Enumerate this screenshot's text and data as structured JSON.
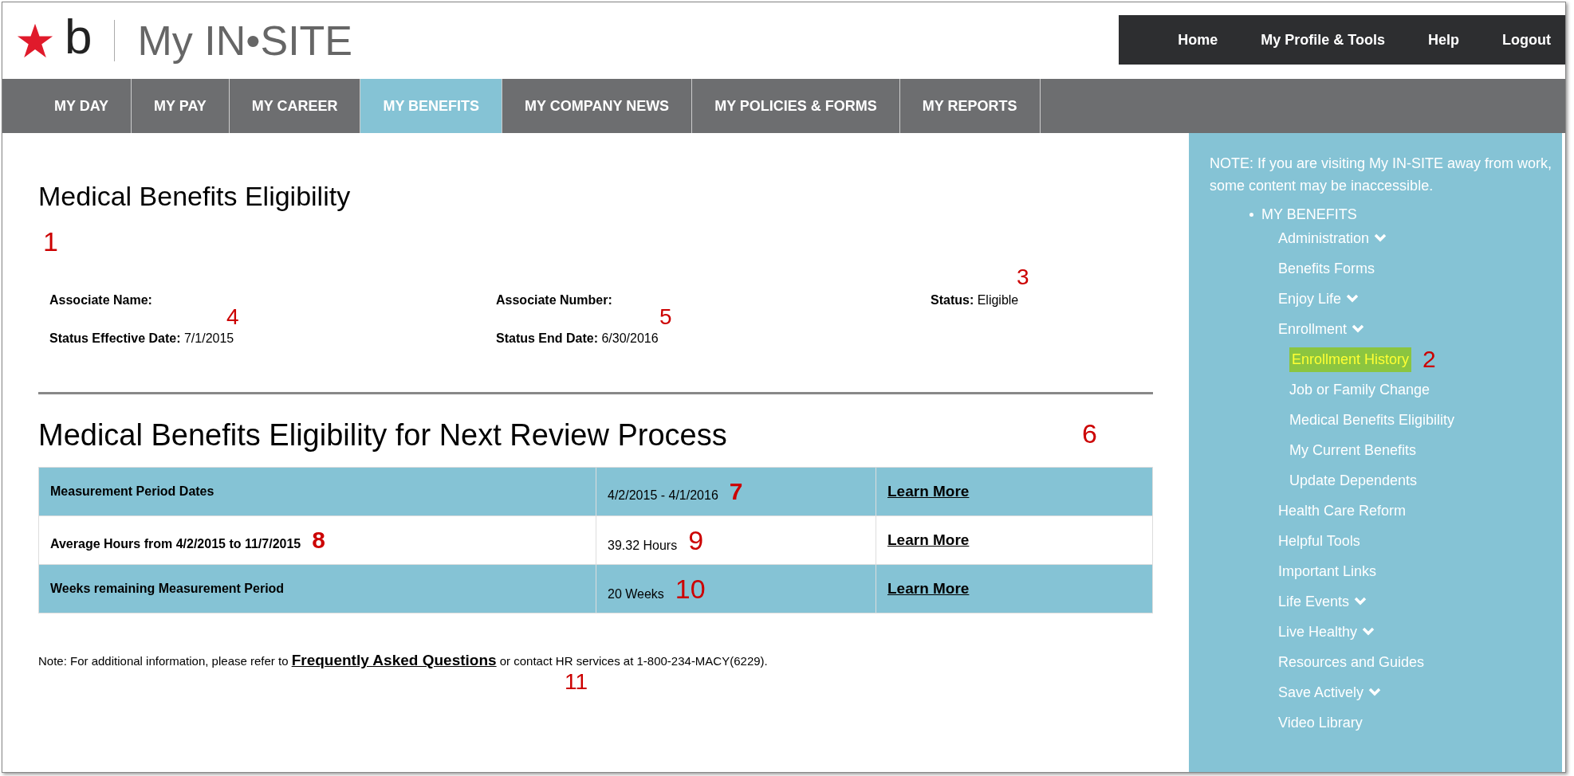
{
  "logo": {
    "letter": "b",
    "site_name": "My IN•SITE"
  },
  "top_links": [
    "Home",
    "My Profile & Tools",
    "Help",
    "Logout"
  ],
  "tabs": [
    {
      "label": "MY DAY",
      "selected": false
    },
    {
      "label": "MY PAY",
      "selected": false
    },
    {
      "label": "MY CAREER",
      "selected": false
    },
    {
      "label": "MY BENEFITS",
      "selected": true
    },
    {
      "label": "MY COMPANY NEWS",
      "selected": false
    },
    {
      "label": "MY POLICIES & FORMS",
      "selected": false
    },
    {
      "label": "MY REPORTS",
      "selected": false
    }
  ],
  "main": {
    "title": "Medical Benefits Eligibility",
    "title_marker": "1",
    "fields": [
      {
        "label": "Associate Name:",
        "marker": "4"
      },
      {
        "label": "Associate Number:",
        "marker": "5"
      },
      {
        "label": "Status:",
        "value": "Eligible",
        "marker": "3"
      },
      {
        "label": "Status Effective Date:",
        "value": "7/1/2015"
      },
      {
        "label": "Status End Date:",
        "value": "6/30/2016"
      }
    ],
    "section_title": "Medical Benefits Eligibility for Next Review Process",
    "section_marker": "6",
    "table": {
      "rows": [
        {
          "label": "Measurement Period Dates",
          "value": "4/2/2015 - 4/1/2016",
          "value_marker": "7",
          "link": "Learn More",
          "shaded": true
        },
        {
          "label": "Average Hours from 4/2/2015 to 11/7/2015",
          "label_marker": "8",
          "value": "39.32 Hours",
          "value_marker": "9",
          "link": "Learn More",
          "shaded": false
        },
        {
          "label": "Weeks remaining Measurement Period",
          "value": "20 Weeks",
          "value_marker": "10",
          "link": "Learn More",
          "shaded": true
        }
      ]
    },
    "note": {
      "before": "Note: For additional information, please refer to",
      "link": "Frequently Asked Questions",
      "after": "or contact HR services at 1-800-234-MACY(6229).",
      "marker": "11"
    }
  },
  "sidebar": {
    "note": "NOTE: If you are visiting My IN-SITE away from work, some content may be inaccessible.",
    "section": "MY BENEFITS",
    "items": [
      {
        "label": "Administration",
        "expandable": true
      },
      {
        "label": "Benefits Forms",
        "expandable": false
      },
      {
        "label": "Enjoy Life",
        "expandable": true
      },
      {
        "label": "Enrollment",
        "expandable": true,
        "children": [
          {
            "label": "Enrollment History",
            "selected": true,
            "marker": "2"
          },
          {
            "label": "Job or Family Change",
            "selected": false
          },
          {
            "label": "Medical Benefits Eligibility",
            "selected": false
          },
          {
            "label": "My Current Benefits",
            "selected": false
          },
          {
            "label": "Update Dependents",
            "selected": false
          }
        ]
      },
      {
        "label": "Health Care Reform",
        "expandable": false
      },
      {
        "label": "Helpful Tools",
        "expandable": false
      },
      {
        "label": "Important Links",
        "expandable": false
      },
      {
        "label": "Life Events",
        "expandable": true
      },
      {
        "label": "Live Healthy",
        "expandable": true
      },
      {
        "label": "Resources and Guides",
        "expandable": false
      },
      {
        "label": "Save Actively",
        "expandable": true
      },
      {
        "label": "Video Library",
        "expandable": false
      }
    ]
  }
}
